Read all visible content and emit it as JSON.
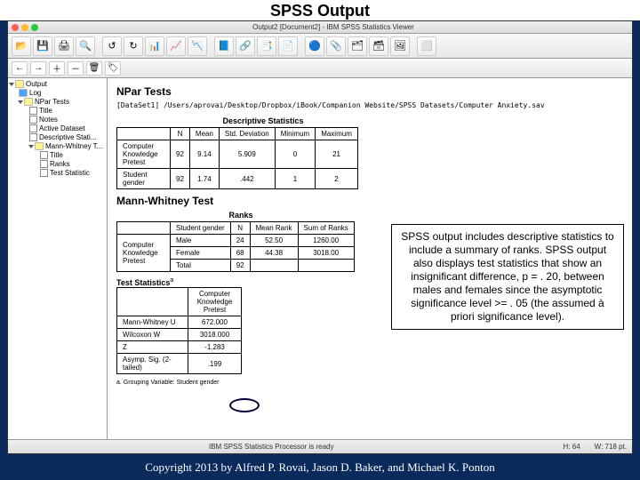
{
  "slide": {
    "title": "SPSS Output"
  },
  "window": {
    "title": "Output2 [Document2] - IBM SPSS Statistics Viewer"
  },
  "toolbar_icons": [
    "📂",
    "💾",
    "🖨",
    "🔍",
    "",
    "↺",
    "↻",
    "📊",
    "📈",
    "📉",
    "",
    "📘",
    "🔗",
    "📑",
    "📄",
    "",
    "🔵",
    "📎",
    "🗂",
    "🗃",
    "🖼",
    "",
    "⬜"
  ],
  "toolbar2_icons": [
    "←",
    "→",
    "＋",
    "－",
    "🗑",
    "🏷"
  ],
  "outline": {
    "root": "Output",
    "items": [
      {
        "label": "Log",
        "selected": true
      },
      {
        "label": "NPar Tests",
        "expanded": true,
        "children": [
          {
            "label": "Title"
          },
          {
            "label": "Notes"
          },
          {
            "label": "Active Dataset"
          },
          {
            "label": "Descriptive Stati..."
          },
          {
            "label": "Mann-Whitney T...",
            "expanded": true,
            "children": [
              {
                "label": "Title"
              },
              {
                "label": "Ranks"
              },
              {
                "label": "Test Statistic"
              }
            ]
          }
        ]
      }
    ]
  },
  "content": {
    "npar_title": "NPar Tests",
    "dataset_line": "[DataSet1] /Users/aprovai/Desktop/Dropbox/iBook/Companion Website/SPSS Datasets/Computer Anxiety.sav",
    "desc_title": "Descriptive Statistics",
    "desc_headers": [
      "",
      "N",
      "Mean",
      "Std. Deviation",
      "Minimum",
      "Maximum"
    ],
    "desc_rows": [
      {
        "label": "Computer Knowledge Pretest",
        "n": "92",
        "mean": "9.14",
        "sd": "5.909",
        "min": "0",
        "max": "21"
      },
      {
        "label": "Student gender",
        "n": "92",
        "mean": "1.74",
        "sd": ".442",
        "min": "1",
        "max": "2"
      }
    ],
    "mw_title": "Mann-Whitney Test",
    "ranks_title": "Ranks",
    "ranks_headers": [
      "",
      "Student gender",
      "N",
      "Mean Rank",
      "Sum of Ranks"
    ],
    "ranks_rows": [
      {
        "var": "Computer Knowledge Pretest",
        "gender": "Male",
        "n": "24",
        "mr": "52.50",
        "sr": "1260.00"
      },
      {
        "var": "",
        "gender": "Female",
        "n": "68",
        "mr": "44.38",
        "sr": "3018.00"
      },
      {
        "var": "",
        "gender": "Total",
        "n": "92",
        "mr": "",
        "sr": ""
      }
    ],
    "teststat_title": "Test Statistics",
    "teststat_sup": "a",
    "teststat_header": "Computer Knowledge Pretest",
    "teststat_rows": [
      {
        "label": "Mann-Whitney U",
        "val": "672.000"
      },
      {
        "label": "Wilcoxon W",
        "val": "3018.000"
      },
      {
        "label": "Z",
        "val": "-1.283"
      },
      {
        "label": "Asymp. Sig. (2-tailed)",
        "val": ".199"
      }
    ],
    "teststat_footnote": "a. Grouping Variable: Student gender"
  },
  "status": {
    "processor": "IBM SPSS Statistics Processor is ready",
    "h": "H: 64",
    "w": "W: 718 pt."
  },
  "callout": {
    "text": "SPSS output includes descriptive statistics to include a summary of ranks. SPSS output also displays test statistics that show an insignificant difference, p = . 20,  between males and females since the asymptotic significance level >= . 05 (the assumed à priori significance level)."
  },
  "copyright": "Copyright 2013 by Alfred P. Rovai, Jason D. Baker, and Michael K. Ponton"
}
